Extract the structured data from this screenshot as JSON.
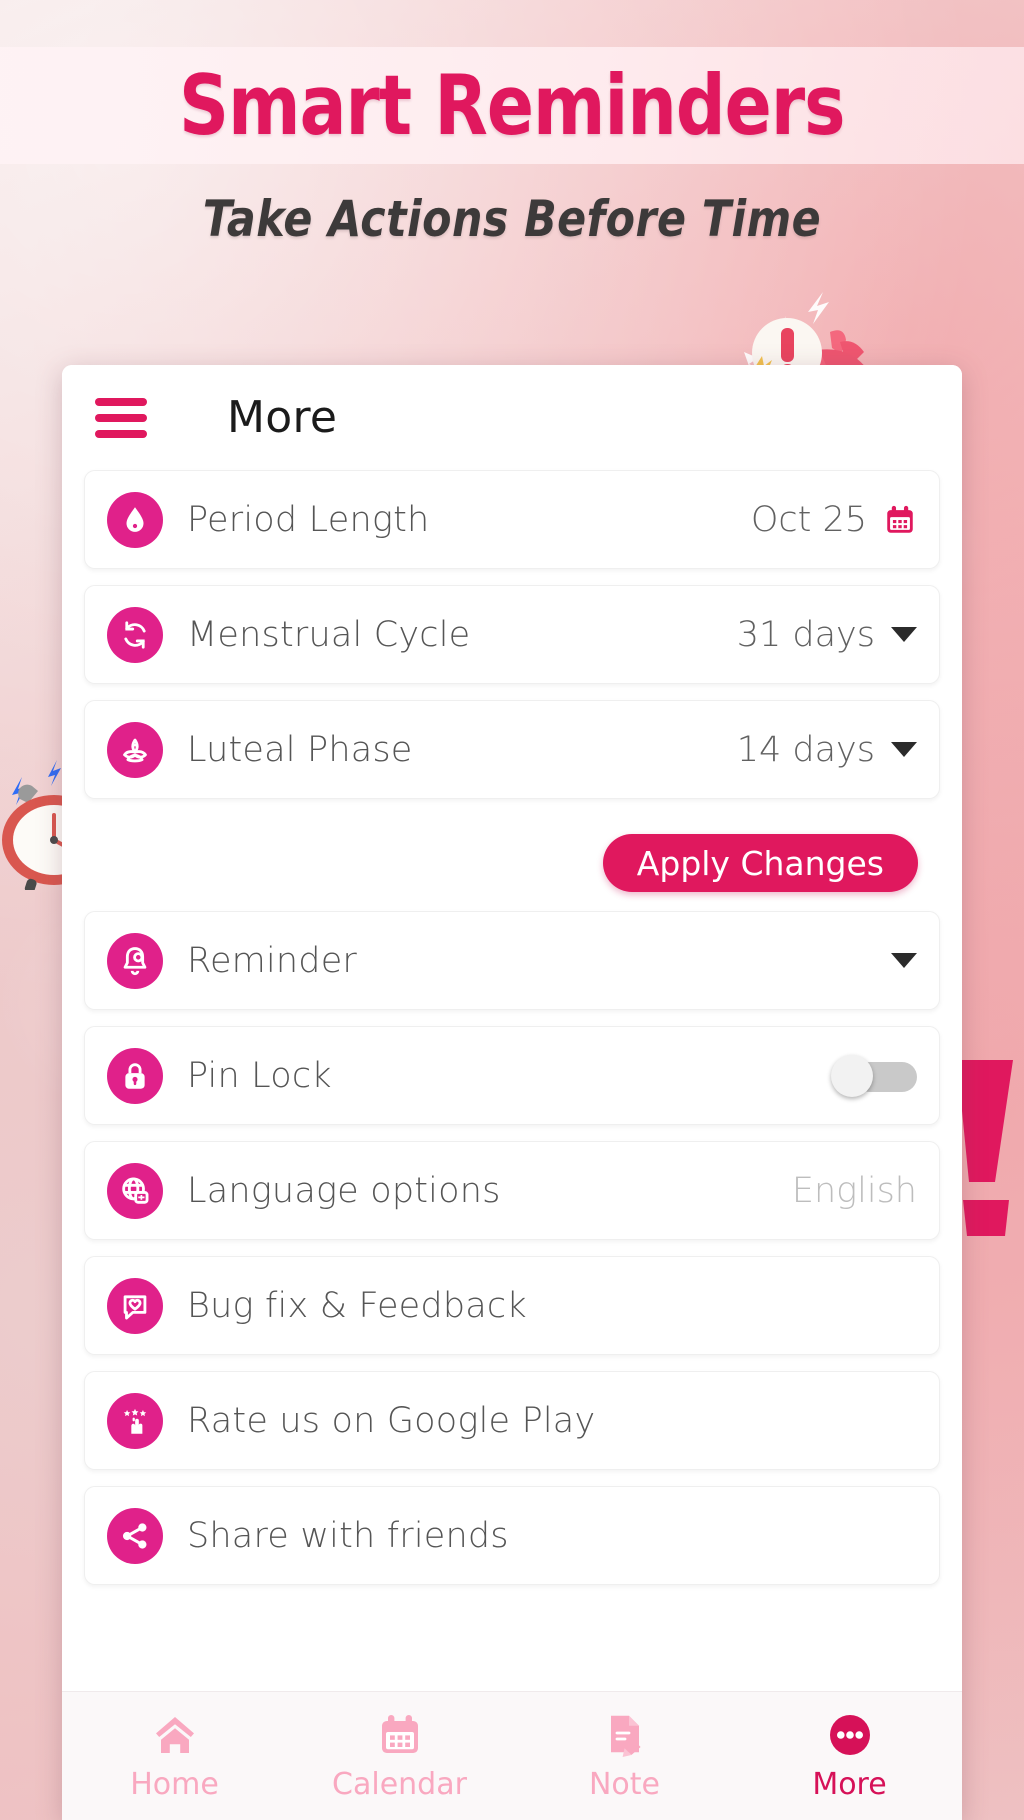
{
  "promo": {
    "headline": "Smart Reminders",
    "subtitle": "Take Actions Before Time",
    "headline_color": "#e0185e",
    "subtitle_color": "#3d3a3a"
  },
  "app": {
    "title": "More",
    "accent": "#e0218a",
    "accent_dark": "#e0185e"
  },
  "settings": {
    "rows": [
      {
        "label": "Period Length",
        "value": "Oct 25",
        "icon": "water-drop-icon",
        "control": "calendar"
      },
      {
        "label": "Menstrual Cycle",
        "value": "31 days",
        "icon": "refresh-cycle-icon",
        "control": "caret"
      },
      {
        "label": "Luteal Phase",
        "value": "14 days",
        "icon": "lotus-flower-icon",
        "control": "caret"
      },
      {
        "label": "Reminder",
        "value": "",
        "icon": "bell-icon",
        "control": "caret"
      },
      {
        "label": "Pin Lock",
        "value": "",
        "icon": "lock-icon",
        "control": "toggle",
        "toggle_on": false
      },
      {
        "label": "Language options",
        "value": "English",
        "icon": "globe-language-icon",
        "control": "text-muted"
      },
      {
        "label": "Bug fix & Feedback",
        "value": "",
        "icon": "feedback-heart-icon",
        "control": "none"
      },
      {
        "label": "Rate us on Google Play",
        "value": "",
        "icon": "rate-stars-icon",
        "control": "none"
      },
      {
        "label": "Share with friends",
        "value": "",
        "icon": "share-icon",
        "control": "none"
      }
    ],
    "apply_button": "Apply Changes"
  },
  "bottom_nav": {
    "items": [
      {
        "label": "Home",
        "icon": "home-icon",
        "active": false
      },
      {
        "label": "Calendar",
        "icon": "calendar-icon",
        "active": false
      },
      {
        "label": "Note",
        "icon": "note-icon",
        "active": false
      },
      {
        "label": "More",
        "icon": "more-dots-icon",
        "active": true
      }
    ]
  },
  "decorations": {
    "bell": "alert-bell-illustration",
    "clock": "alarm-clock-illustration",
    "exclaim": "exclamation-mark-graphic"
  }
}
